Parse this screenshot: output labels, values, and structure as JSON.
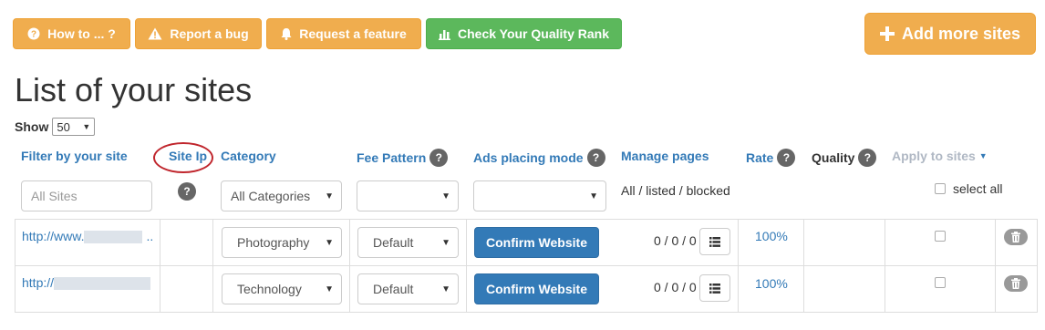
{
  "toolbar": {
    "how_to": "How to ... ?",
    "report_bug": "Report a bug",
    "request_feature": "Request a feature",
    "quality_rank": "Check Your Quality Rank",
    "add_sites": "Add more sites"
  },
  "page": {
    "title": "List of your sites",
    "show_label": "Show",
    "show_value": "50"
  },
  "columns": {
    "filter_site": "Filter by your site",
    "site_ip": "Site Ip",
    "category": "Category",
    "fee_pattern": "Fee Pattern",
    "ads_mode": "Ads placing mode",
    "manage_pages": "Manage pages",
    "rate": "Rate",
    "quality": "Quality",
    "apply_sites": "Apply to sites",
    "help": "?"
  },
  "filters": {
    "site_placeholder": "All Sites",
    "category_value": "All Categories",
    "fee_value": "",
    "ads_value": "",
    "manage_pages_text": "All / listed / blocked",
    "select_all": "select all"
  },
  "rows": [
    {
      "url_prefix": "http://www.",
      "url_suffix": "..",
      "category": "Photography",
      "fee": "Default",
      "action": "Confirm Website",
      "pages": "0 / 0 / 0",
      "rate": "100%"
    },
    {
      "url_prefix": "http://",
      "url_suffix": "",
      "category": "Technology",
      "fee": "Default",
      "action": "Confirm Website",
      "pages": "0 / 0 / 0",
      "rate": "100%"
    }
  ],
  "colors": {
    "warning": "#f0ad4e",
    "success": "#5cb85c",
    "primary": "#337ab7",
    "annotation": "#c0262d"
  },
  "icons": [
    "question-circle-icon",
    "warning-icon",
    "bell-icon",
    "bar-chart-icon",
    "plus-icon",
    "list-icon",
    "trash-icon",
    "caret-down-icon"
  ]
}
